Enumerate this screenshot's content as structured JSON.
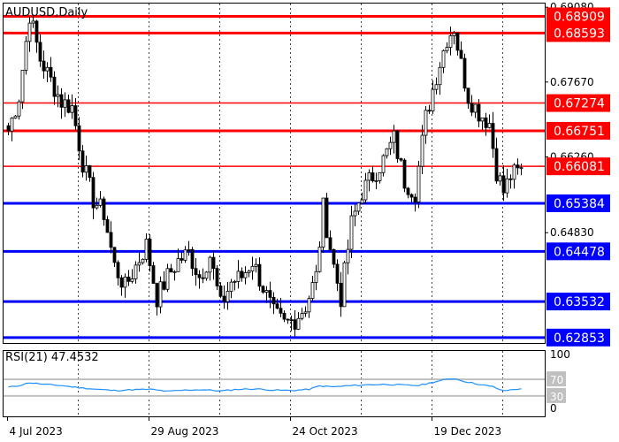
{
  "chart_data": [
    {
      "type": "candlestick",
      "title": "AUDUSD,Daily",
      "ylim": [
        0.6275,
        0.6915
      ],
      "y_ticks": [
        "0.69080",
        "0.67670",
        "0.66260",
        "0.64830"
      ],
      "y_tick_values": [
        0.6908,
        0.6767,
        0.6626,
        0.6483
      ],
      "x_ticks": [
        "4 Jul 2023",
        "29 Aug 2023",
        "24 Oct 2023",
        "19 Dec 2023"
      ],
      "x_tick_index": [
        0,
        40,
        80,
        120
      ],
      "bar_count": 146,
      "grid": true,
      "colors": {
        "candle": "#000000",
        "resistance": "#ff0000",
        "support": "#0000ff"
      },
      "levels": [
        {
          "value": 0.68909,
          "label": "0.68909",
          "kind": "resistance",
          "weight": "thick"
        },
        {
          "value": 0.68593,
          "label": "0.68593",
          "kind": "resistance",
          "weight": "thick"
        },
        {
          "value": 0.67274,
          "label": "0.67274",
          "kind": "resistance",
          "weight": "thin"
        },
        {
          "value": 0.66751,
          "label": "0.66751",
          "kind": "resistance",
          "weight": "thick"
        },
        {
          "value": 0.66081,
          "label": "0.66081",
          "kind": "resistance",
          "weight": "thin"
        },
        {
          "value": 0.65384,
          "label": "0.65384",
          "kind": "support",
          "weight": "thick"
        },
        {
          "value": 0.64478,
          "label": "0.64478",
          "kind": "support",
          "weight": "thick"
        },
        {
          "value": 0.63532,
          "label": "0.63532",
          "kind": "support",
          "weight": "thick"
        },
        {
          "value": 0.62853,
          "label": "0.62853",
          "kind": "support",
          "weight": "thick"
        }
      ],
      "close_anchors": [
        [
          0,
          0.6675
        ],
        [
          3,
          0.674
        ],
        [
          6,
          0.6895
        ],
        [
          9,
          0.681
        ],
        [
          12,
          0.677
        ],
        [
          15,
          0.673
        ],
        [
          18,
          0.672
        ],
        [
          21,
          0.6615
        ],
        [
          24,
          0.6545
        ],
        [
          27,
          0.652
        ],
        [
          30,
          0.642
        ],
        [
          33,
          0.638
        ],
        [
          36,
          0.642
        ],
        [
          39,
          0.646
        ],
        [
          42,
          0.636
        ],
        [
          45,
          0.64
        ],
        [
          48,
          0.643
        ],
        [
          51,
          0.6445
        ],
        [
          54,
          0.64
        ],
        [
          57,
          0.644
        ],
        [
          60,
          0.6345
        ],
        [
          63,
          0.639
        ],
        [
          66,
          0.64
        ],
        [
          69,
          0.643
        ],
        [
          72,
          0.638
        ],
        [
          75,
          0.633
        ],
        [
          78,
          0.631
        ],
        [
          81,
          0.632
        ],
        [
          84,
          0.6345
        ],
        [
          87,
          0.64
        ],
        [
          89,
          0.653
        ],
        [
          92,
          0.642
        ],
        [
          94,
          0.636
        ],
        [
          97,
          0.65
        ],
        [
          100,
          0.656
        ],
        [
          103,
          0.659
        ],
        [
          106,
          0.662
        ],
        [
          109,
          0.666
        ],
        [
          112,
          0.658
        ],
        [
          115,
          0.656
        ],
        [
          118,
          0.67
        ],
        [
          121,
          0.678
        ],
        [
          124,
          0.685
        ],
        [
          126,
          0.687
        ],
        [
          128,
          0.68
        ],
        [
          130,
          0.674
        ],
        [
          133,
          0.671
        ],
        [
          136,
          0.669
        ],
        [
          138,
          0.66
        ],
        [
          140,
          0.656
        ],
        [
          142,
          0.659
        ],
        [
          145,
          0.66
        ]
      ]
    },
    {
      "type": "line",
      "title": "RSI(21) 47.4532",
      "ylim": [
        0,
        100
      ],
      "y_ticks": [
        "100",
        "70",
        "30",
        "0"
      ],
      "y_tick_values": [
        100,
        70,
        30,
        0
      ],
      "colors": {
        "line": "#1e90ff",
        "level": "#c0c0c0"
      },
      "levels": [
        70,
        30
      ],
      "last_value": 47.4532,
      "series": [
        {
          "anchors": [
            [
              0,
              51
            ],
            [
              3,
              55
            ],
            [
              6,
              62
            ],
            [
              10,
              58
            ],
            [
              15,
              55
            ],
            [
              20,
              50
            ],
            [
              25,
              46
            ],
            [
              30,
              43
            ],
            [
              35,
              45
            ],
            [
              40,
              46
            ],
            [
              45,
              41
            ],
            [
              50,
              44
            ],
            [
              55,
              45
            ],
            [
              60,
              42
            ],
            [
              65,
              46
            ],
            [
              70,
              47
            ],
            [
              75,
              44
            ],
            [
              80,
              43
            ],
            [
              85,
              46
            ],
            [
              88,
              54
            ],
            [
              92,
              52
            ],
            [
              97,
              55
            ],
            [
              102,
              57
            ],
            [
              107,
              58
            ],
            [
              112,
              56
            ],
            [
              116,
              55
            ],
            [
              120,
              63
            ],
            [
              124,
              70
            ],
            [
              126,
              72
            ],
            [
              129,
              65
            ],
            [
              133,
              58
            ],
            [
              137,
              52
            ],
            [
              140,
              42
            ],
            [
              143,
              46
            ],
            [
              145,
              47.4532
            ]
          ]
        }
      ]
    }
  ]
}
